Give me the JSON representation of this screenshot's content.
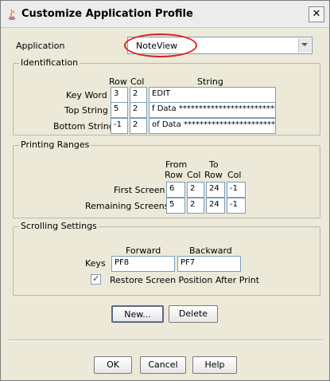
{
  "window": {
    "title": "Customize Application Profile",
    "close_glyph": "✕"
  },
  "application": {
    "label": "Application",
    "value": "NoteView"
  },
  "identification": {
    "title": "Identification",
    "headers": {
      "row": "Row",
      "col": "Col",
      "string": "String"
    },
    "rows": [
      {
        "label": "Key Word",
        "row": "3",
        "col": "2",
        "string": "EDIT"
      },
      {
        "label": "Top String",
        "row": "5",
        "col": "2",
        "string": "f Data ******************************"
      },
      {
        "label": "Bottom String",
        "row": "-1",
        "col": "2",
        "string": " of Data ****************************"
      }
    ]
  },
  "printing": {
    "title": "Printing Ranges",
    "headers": {
      "from": "From",
      "to": "To",
      "row1": "Row",
      "col1": "Col",
      "row2": "Row",
      "col2": "Col"
    },
    "rows": [
      {
        "label": "First Screen",
        "from_row": "6",
        "from_col": "2",
        "to_row": "24",
        "to_col": "-1"
      },
      {
        "label": "Remaining Screens",
        "from_row": "5",
        "from_col": "2",
        "to_row": "24",
        "to_col": "-1"
      }
    ]
  },
  "scrolling": {
    "title": "Scrolling Settings",
    "forward_label": "Forward",
    "backward_label": "Backward",
    "keys_label": "Keys",
    "forward_value": "PF8",
    "backward_value": "PF7",
    "restore_label": "Restore Screen Position After Print",
    "restore_checked": true,
    "check_glyph": "✓"
  },
  "actions": {
    "new_label": "New...",
    "delete_label": "Delete"
  },
  "footer": {
    "ok_label": "OK",
    "cancel_label": "Cancel",
    "help_label": "Help"
  }
}
